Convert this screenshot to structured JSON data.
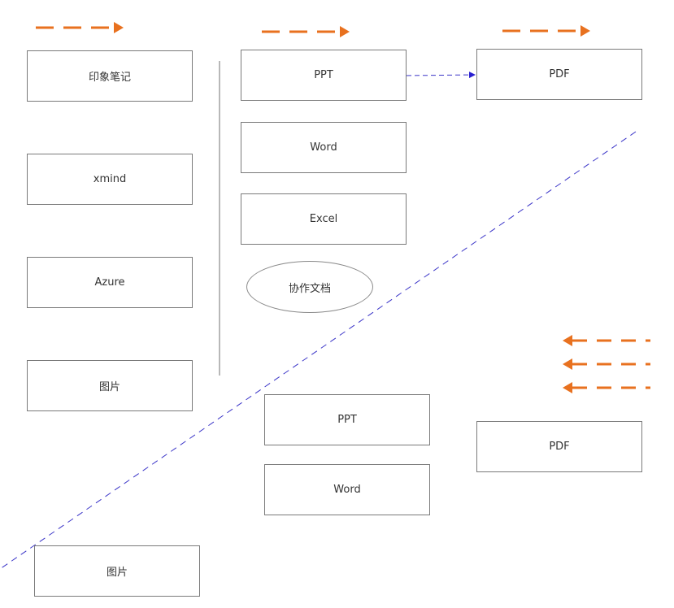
{
  "colors": {
    "orange_arrow": "#e8711f",
    "blue_dashed": "#3b35c8",
    "box_border": "#7a7a7a",
    "divider": "#8a8a8a"
  },
  "left_column": [
    {
      "label": "印象笔记"
    },
    {
      "label": "xmind"
    },
    {
      "label": "Azure"
    },
    {
      "label": "图片"
    }
  ],
  "middle_column_top": [
    {
      "label": "PPT"
    },
    {
      "label": "Word"
    },
    {
      "label": "Excel"
    }
  ],
  "ellipse": {
    "label": "协作文档"
  },
  "right_top": {
    "label": "PDF"
  },
  "middle_column_bottom": [
    {
      "label": "PPT"
    },
    {
      "label": "Word"
    }
  ],
  "right_bottom": {
    "label": "PDF"
  },
  "bottom_left": {
    "label": "图片"
  },
  "arrows": {
    "top_right_arrows": 3,
    "bottom_left_arrows": 3
  }
}
